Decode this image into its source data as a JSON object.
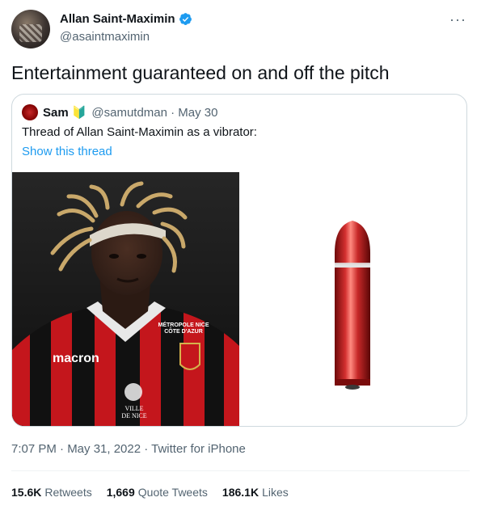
{
  "author": {
    "name": "Allan Saint-Maximin",
    "handle": "@asaintmaximin"
  },
  "tweet": {
    "text": "Entertainment guaranteed on and off the pitch",
    "meta": "7:07 PM · May 31, 2022 · Twitter for iPhone"
  },
  "quote": {
    "name": "Sam",
    "badge": "🔰",
    "handle_date": "@samutdman · May 30",
    "text": "Thread of Allan Saint-Maximin as a vibrator:",
    "show_thread": "Show this thread"
  },
  "image_left": {
    "jersey_brand": "macron",
    "sponsor": "MÉTROPOLE NICE CÔTE D'AZUR",
    "crest_text": "VILLE DE NICE"
  },
  "stats": {
    "retweets_count": "15.6K",
    "retweets_label": "Retweets",
    "quotes_count": "1,669",
    "quotes_label": "Quote Tweets",
    "likes_count": "186.1K",
    "likes_label": "Likes"
  },
  "colors": {
    "accent": "#1d9bf0",
    "secondary_text": "#536471",
    "border": "#cfd9de",
    "product_red": "#c41a1a"
  },
  "icons": {
    "verified": "verified-badge-icon",
    "more": "more-options-icon"
  }
}
